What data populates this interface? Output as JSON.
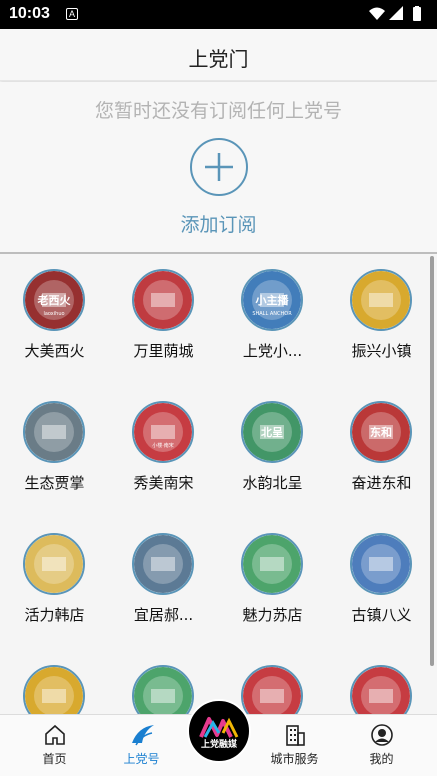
{
  "status": {
    "time": "10:03",
    "notif_letter": "A"
  },
  "header": {
    "title": "上党门"
  },
  "subscribe": {
    "message": "您暂时还没有订阅任何上党号",
    "add_label": "添加订阅"
  },
  "accounts": [
    {
      "name": "大美西火",
      "logo_text": "老西火",
      "logo_sub": "laoxihuo",
      "color": "#8b1a1a"
    },
    {
      "name": "万里荫城",
      "color": "#b8262b"
    },
    {
      "name": "上党小...",
      "logo_text": "小主播",
      "logo_sub": "SHALL ANCHOR",
      "color": "#2d6fb3"
    },
    {
      "name": "振兴小镇",
      "color": "#d4a017"
    },
    {
      "name": "生态贾掌",
      "color": "#5a6e7a"
    },
    {
      "name": "秀美南宋",
      "logo_sub": "小楼·南宋",
      "color": "#c0272d"
    },
    {
      "name": "水韵北呈",
      "logo_text": "北呈",
      "color": "#2e8b57"
    },
    {
      "name": "奋进东和",
      "logo_text": "东和",
      "color": "#b22222"
    },
    {
      "name": "活力韩店",
      "color": "#d9b44a"
    },
    {
      "name": "宜居郝...",
      "color": "#4a6b8a"
    },
    {
      "name": "魅力苏店",
      "color": "#3a9a5b"
    },
    {
      "name": "古镇八义",
      "color": "#3b6fb5"
    },
    {
      "name": "",
      "color": "#d4a017"
    },
    {
      "name": "",
      "color": "#3a9a5b"
    },
    {
      "name": "",
      "color": "#c0272d"
    },
    {
      "name": "",
      "color": "#c0272d"
    }
  ],
  "tabs": [
    {
      "label": "首页",
      "icon": "home-icon"
    },
    {
      "label": "上党号",
      "icon": "shangdang-icon",
      "active": true
    },
    {
      "label": "",
      "icon": "center-logo"
    },
    {
      "label": "城市服务",
      "icon": "building-icon"
    },
    {
      "label": "我的",
      "icon": "user-icon"
    }
  ],
  "center_logo": {
    "text": "上党融媒"
  }
}
